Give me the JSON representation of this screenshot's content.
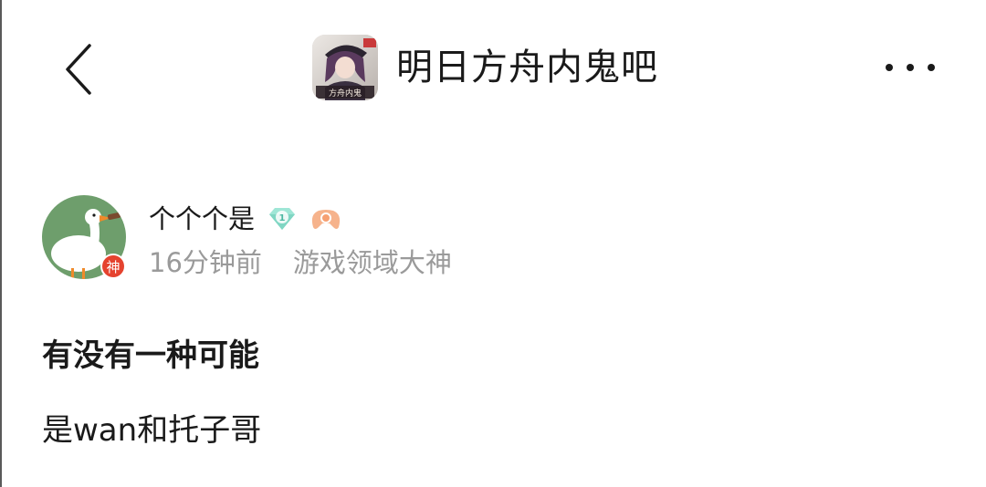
{
  "forum": {
    "name": "明日方舟内鬼吧",
    "avatar_caption": "方舟内鬼"
  },
  "icons": {
    "back": "chevron-left-icon",
    "more": "more-dots-icon",
    "level_badge": "diamond-level-icon",
    "game_badge": "gamepad-icon"
  },
  "post": {
    "author": {
      "name": "个个个是",
      "level": "1",
      "avatar_badge": "神",
      "time": "16分钟前",
      "title": "游戏领域大神"
    },
    "title": "有没有一种可能",
    "body": "是wan和托子哥"
  },
  "colors": {
    "accent_red": "#e5432f",
    "meta_gray": "#9a9a9a",
    "level_teal": "#8fe0cf",
    "game_orange": "#f3a77a"
  }
}
